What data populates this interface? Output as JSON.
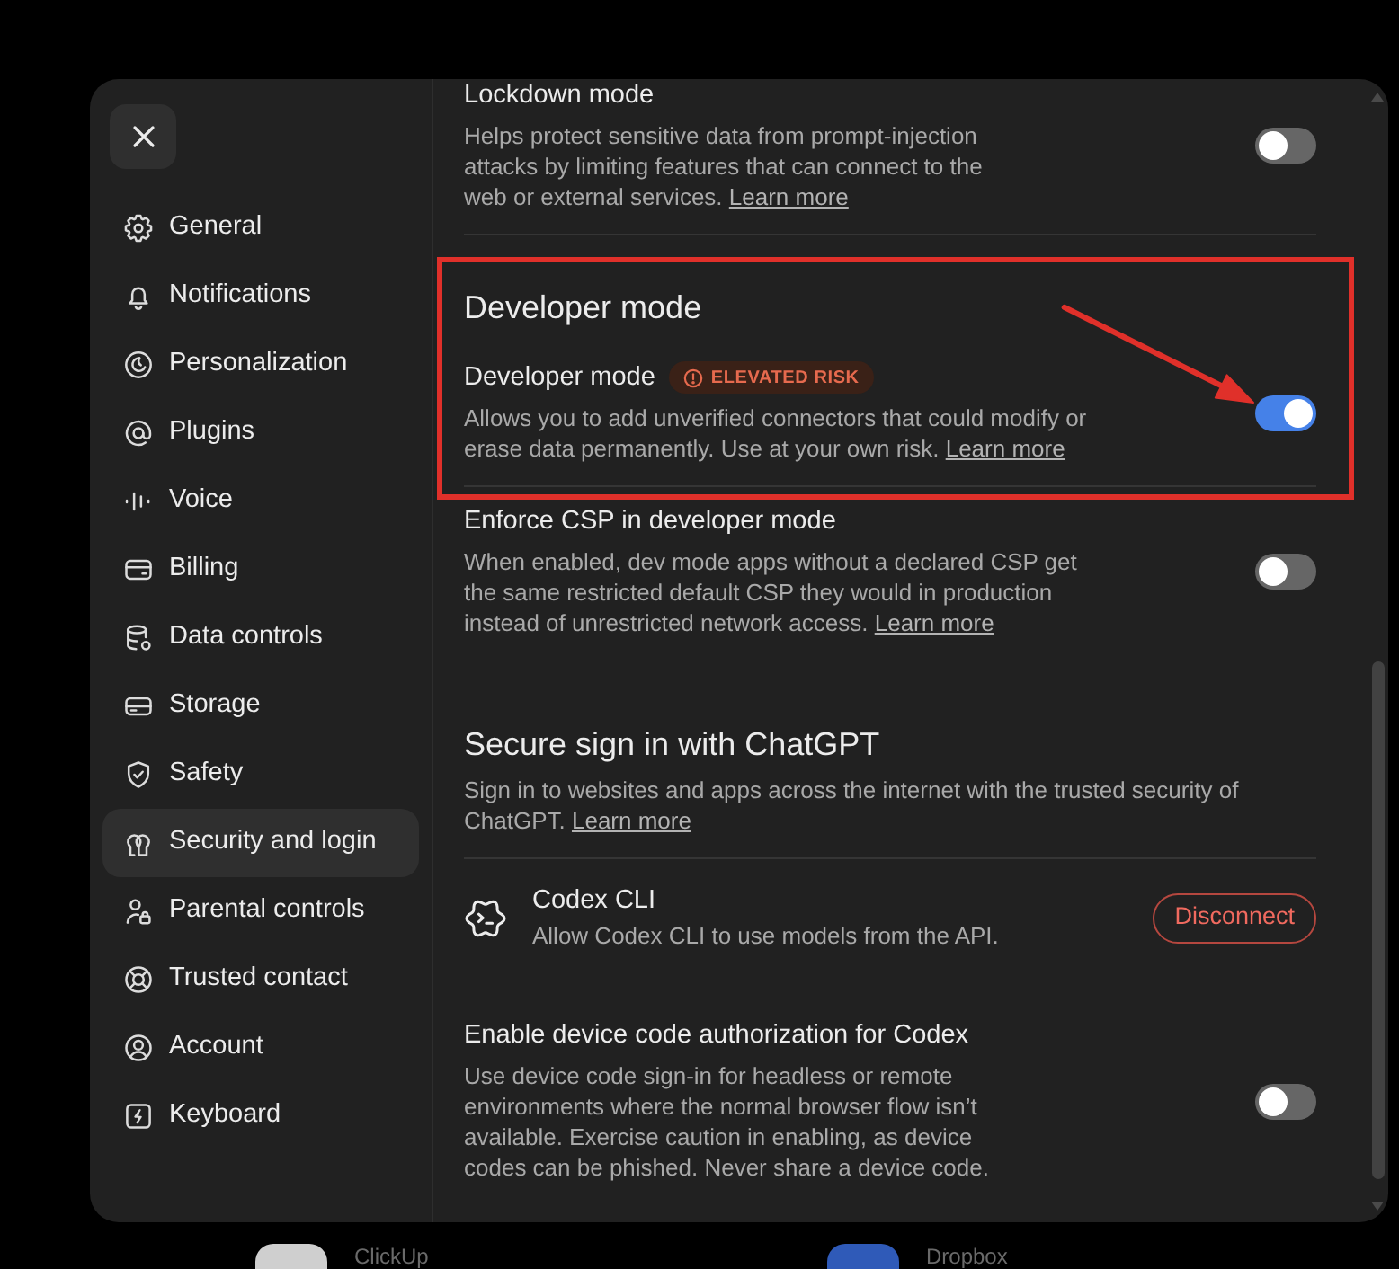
{
  "sidebar": {
    "items": [
      {
        "label": "General",
        "selected": false
      },
      {
        "label": "Notifications",
        "selected": false
      },
      {
        "label": "Personalization",
        "selected": false
      },
      {
        "label": "Plugins",
        "selected": false
      },
      {
        "label": "Voice",
        "selected": false
      },
      {
        "label": "Billing",
        "selected": false
      },
      {
        "label": "Data controls",
        "selected": false
      },
      {
        "label": "Storage",
        "selected": false
      },
      {
        "label": "Safety",
        "selected": false
      },
      {
        "label": "Security and login",
        "selected": true
      },
      {
        "label": "Parental controls",
        "selected": false
      },
      {
        "label": "Trusted contact",
        "selected": false
      },
      {
        "label": "Account",
        "selected": false
      },
      {
        "label": "Keyboard",
        "selected": false
      }
    ]
  },
  "content": {
    "items": [
      {
        "kind": "setting",
        "title": "Lockdown mode",
        "description": "Helps protect sensitive data from prompt-injection attacks by limiting features that can connect to the web or external services.",
        "link": "Learn more",
        "on": false,
        "divider_below": true,
        "annotated": false
      },
      {
        "kind": "heading",
        "title": "Developer mode",
        "divider_below": false,
        "annotated": true
      },
      {
        "kind": "setting",
        "title": "Developer mode",
        "badge": "ELEVATED RISK",
        "description": "Allows you to add unverified connectors that could modify or erase data permanently. Use at your own risk.",
        "link": "Learn more",
        "on": true,
        "divider_below": true,
        "annotated": true
      },
      {
        "kind": "setting",
        "title": "Enforce CSP in developer mode",
        "description": "When enabled, dev mode apps without a declared CSP get the same restricted default CSP they would in production instead of unrestricted network access.",
        "link": "Learn more",
        "on": false,
        "divider_below": false,
        "annotated": false
      },
      {
        "kind": "heading",
        "title": "Secure sign in with ChatGPT",
        "description": "Sign in to websites and apps across the internet with the trusted security of ChatGPT.",
        "link": "Learn more",
        "divider_below": true,
        "annotated": false
      },
      {
        "kind": "connection",
        "title": "Codex CLI",
        "description": "Allow Codex CLI to use models from the API.",
        "button": "Disconnect",
        "divider_below": false,
        "annotated": false
      },
      {
        "kind": "setting",
        "title": "Enable device code authorization for Codex",
        "description": "Use device code sign-in for headless or remote environments where the normal browser flow isn’t available. Exercise caution in enabling, as device codes can be phished. Never share a device code.",
        "on": false,
        "divider_below": false,
        "annotated": false
      }
    ]
  },
  "background_apps": [
    {
      "label": "ClickUp",
      "color": "#cfcfcf"
    },
    {
      "label": "Dropbox",
      "color": "#2f5ab8"
    }
  ]
}
